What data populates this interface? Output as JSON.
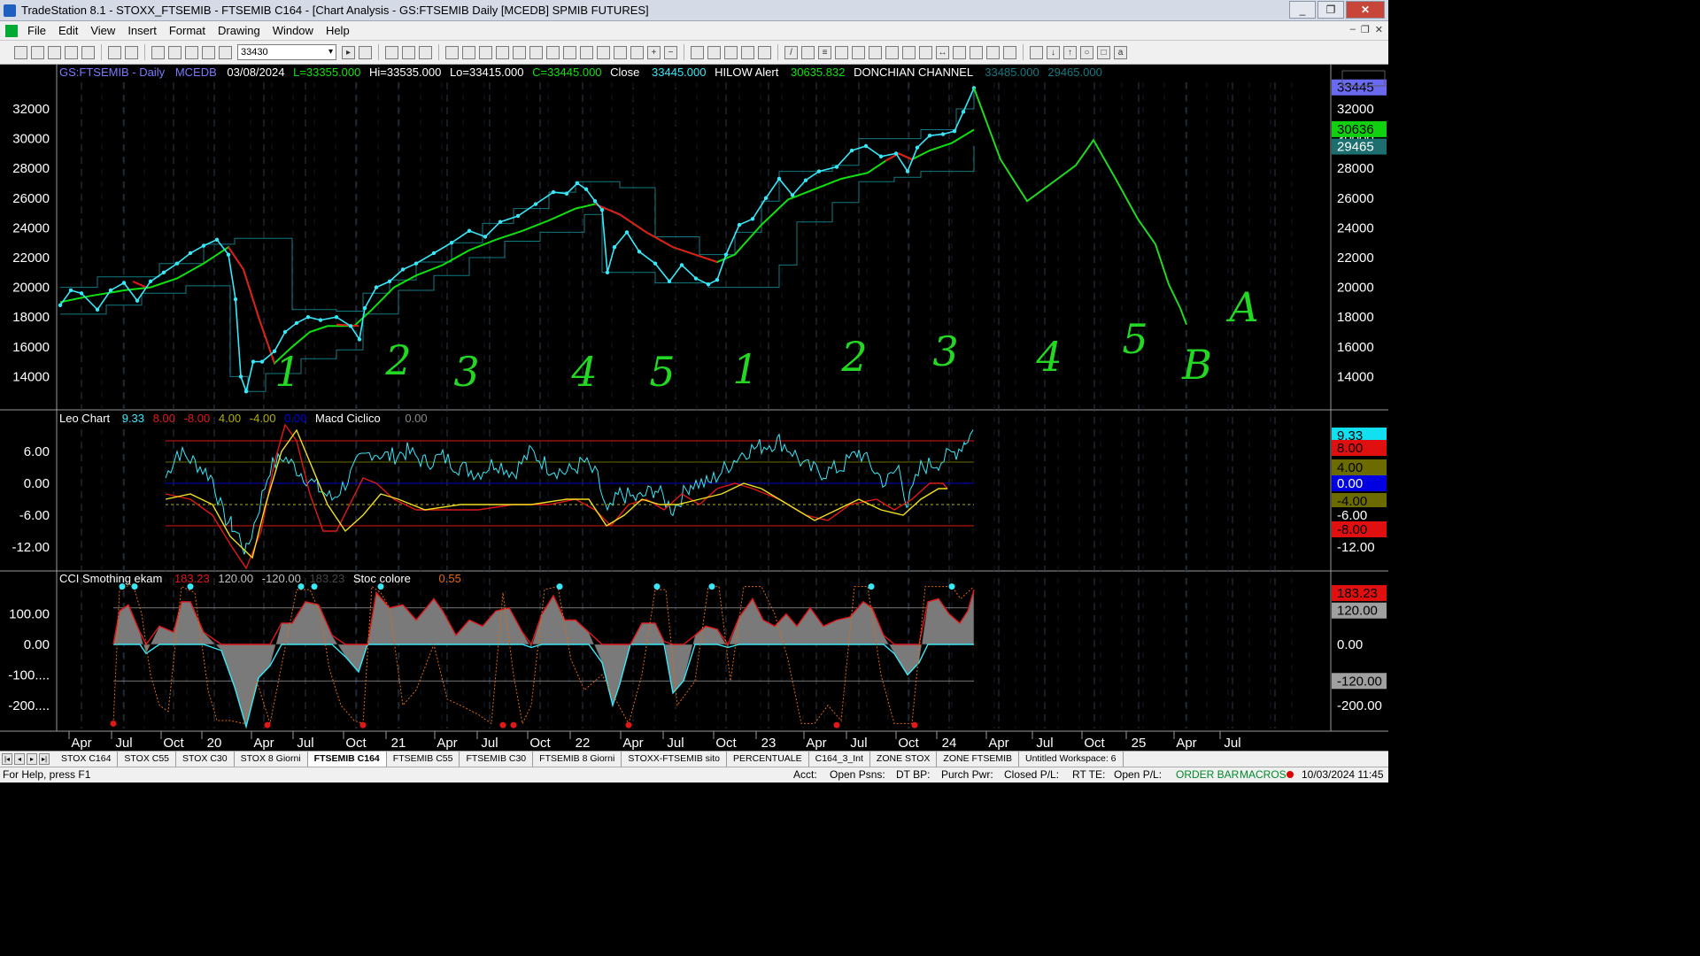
{
  "window": {
    "title": "TradeStation 8.1 - STOXX_FTSEMIB - FTSEMIB C164 - [Chart Analysis - GS:FTSEMIB  Daily  [MCEDB] SPMIB FUTURES]",
    "minimize": "_",
    "maximize": "❐",
    "close": "✕"
  },
  "menu": [
    "File",
    "Edit",
    "View",
    "Insert",
    "Format",
    "Drawing",
    "Window",
    "Help"
  ],
  "toolbar": {
    "symbol_value": "33430"
  },
  "price_panel": {
    "symbol": "GS:FTSEMIB - Daily",
    "datasource": "MCEDB",
    "date": "03/08/2024",
    "last": "L=33355.000",
    "hi": "Hi=33535.000",
    "lo": "Lo=33415.000",
    "close_eq": "C=33445.000",
    "close_label": "Close",
    "close_value": "33445.000",
    "hilow_label": "HILOW Alert",
    "hilow_value": "30635.832",
    "donchian_label": "DONCHIAN CHANNEL",
    "donchian_hi": "33485.000",
    "donchian_lo": "29465.000",
    "right_badges": [
      {
        "text": "33445",
        "bg": "#6a6af0",
        "fg": "#000"
      },
      {
        "text": "30636",
        "bg": "#10d010",
        "fg": "#000"
      },
      {
        "text": "29465",
        "bg": "#1d6e6e",
        "fg": "#fff"
      }
    ]
  },
  "price_axis": [
    "32000",
    "30000",
    "28000",
    "26000",
    "24000",
    "22000",
    "20000",
    "18000",
    "16000",
    "14000"
  ],
  "wave_labels": [
    "1",
    "2",
    "3",
    "4",
    "5",
    "1",
    "2",
    "3",
    "4",
    "5",
    "A",
    "B"
  ],
  "leo_panel": {
    "name": "Leo Chart",
    "v1": "9.33",
    "v2": "8.00",
    "v3": "-8.00",
    "v4": "4.00",
    "v5": "-4.00",
    "v6": "0.00",
    "macd_label": "Macd Ciclico",
    "macd_value": "0.00",
    "axis": [
      "6.00",
      "0.00",
      "-6.00",
      "-12.00"
    ],
    "right_axis": [
      "6.00",
      "0.00",
      "-6.00",
      "-12.00"
    ],
    "badges": [
      {
        "text": "9.33",
        "bg": "#10e0f0",
        "fg": "#000"
      },
      {
        "text": "8.00",
        "bg": "#e01010",
        "fg": "#000"
      },
      {
        "text": "4.00",
        "bg": "#6b6b00",
        "fg": "#000"
      },
      {
        "text": "0.00",
        "bg": "#0000e0",
        "fg": "#fff"
      },
      {
        "text": "-4.00",
        "bg": "#6b6b00",
        "fg": "#000"
      },
      {
        "text": "-6.00",
        "bg": "#000",
        "fg": "#fff"
      },
      {
        "text": "-8.00",
        "bg": "#e01010",
        "fg": "#000"
      }
    ]
  },
  "cci_panel": {
    "name": "CCI Smothing ekam",
    "v1": "183.23",
    "v2": "120.00",
    "v3": "-120.00",
    "v4": "183.23",
    "stoc_label": "Stoc colore",
    "stoc_value": "0.55",
    "axis": [
      "100.00",
      "0.00",
      "-100....",
      "-200...."
    ],
    "right_axis": [
      "100.00",
      "0.00",
      "-200.00"
    ],
    "badges": [
      {
        "text": "183.23",
        "bg": "#e01010",
        "fg": "#000"
      },
      {
        "text": "120.00",
        "bg": "#a0a0a0",
        "fg": "#000"
      },
      {
        "text": "-120.00",
        "bg": "#a0a0a0",
        "fg": "#000"
      }
    ]
  },
  "time_axis": [
    "Apr",
    "Jul",
    "Oct",
    "20",
    "Apr",
    "Jul",
    "Oct",
    "21",
    "Apr",
    "Jul",
    "Oct",
    "22",
    "Apr",
    "Jul",
    "Oct",
    "23",
    "Apr",
    "Jul",
    "Oct",
    "24",
    "Apr",
    "Jul",
    "Oct",
    "25",
    "Apr",
    "Jul"
  ],
  "tabs": [
    "STOX C164",
    "STOX C55",
    "STOX  C30",
    "STOX  8 Giorni",
    "FTSEMIB C164",
    "FTSEMIB C55",
    "FTSEMIB C30",
    "FTSEMIB  8 Giorni",
    "STOXX-FTSEMIB sito",
    "PERCENTUALE",
    "C164_3_Int",
    "ZONE STOX",
    "ZONE FTSEMIB",
    "Untitled Workspace:  6"
  ],
  "active_tab": "FTSEMIB C164",
  "status": {
    "help": "For Help, press F1",
    "acct": "Acct:",
    "open_psns": "Open Psns:",
    "dt_bp": "DT BP:",
    "purch_pwr": "Purch Pwr:",
    "closed_pl": "Closed P/L:",
    "rt_te": "RT TE:",
    "open_pl": "Open P/L:",
    "order_bar": "ORDER BAR",
    "macros": "MACROS",
    "datetime": "10/03/2024 11:45"
  },
  "colors": {
    "price": "#38e8f8",
    "ma": "#10e010",
    "ma_down": "#e01818",
    "channel": "#127a82",
    "drawing": "#22d822",
    "yellow": "#f0e020",
    "red": "#e01818"
  }
}
